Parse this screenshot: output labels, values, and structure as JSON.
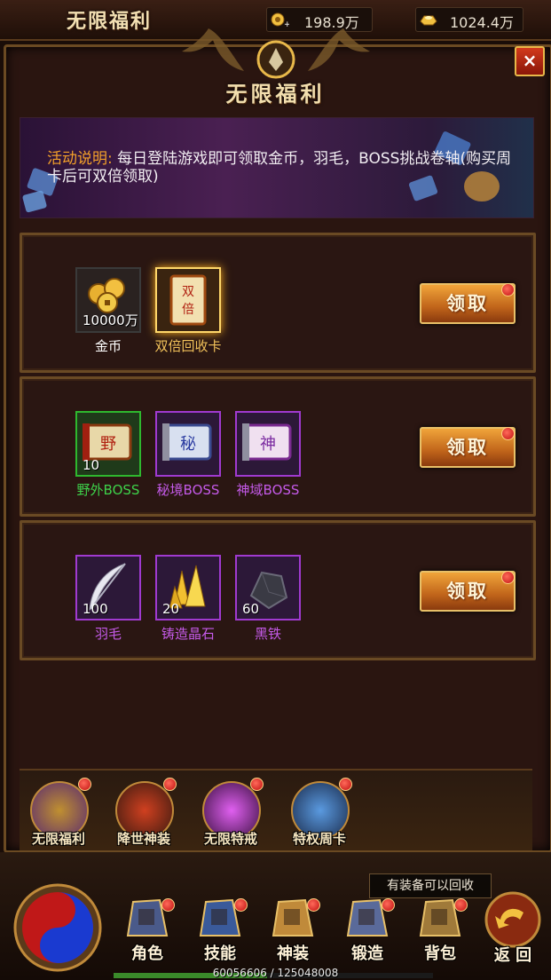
{
  "header": {
    "title": "无限福利",
    "gold": "198.9万",
    "ingot": "1024.4万"
  },
  "panel": {
    "title": "无限福利",
    "close_label": "×",
    "description_label": "活动说明:",
    "description_text": "每日登陆游戏即可领取金币，羽毛，BOSS挑战卷轴(购买周卡后可双倍领取)"
  },
  "rows": [
    {
      "items": [
        {
          "name": "金币",
          "count": "10000万",
          "name_color": "#ffffff",
          "icon": "gold-coins-icon"
        },
        {
          "name": "双倍回收卡",
          "count": "",
          "name_color": "#f2c25a",
          "icon": "double-recycle-card-icon"
        }
      ],
      "button": "领取"
    },
    {
      "items": [
        {
          "name": "野外BOSS",
          "count": "10",
          "name_color": "#3ed24a",
          "icon": "wild-boss-scroll-icon"
        },
        {
          "name": "秘境BOSS",
          "count": "",
          "name_color": "#c45ae8",
          "icon": "secret-boss-scroll-icon"
        },
        {
          "name": "神域BOSS",
          "count": "",
          "name_color": "#c45ae8",
          "icon": "divine-boss-scroll-icon"
        }
      ],
      "button": "领取"
    },
    {
      "items": [
        {
          "name": "羽毛",
          "count": "100",
          "name_color": "#c45ae8",
          "icon": "feather-icon"
        },
        {
          "name": "铸造晶石",
          "count": "20",
          "name_color": "#c45ae8",
          "icon": "forge-crystal-icon"
        },
        {
          "name": "黑铁",
          "count": "60",
          "name_color": "#c45ae8",
          "icon": "black-iron-icon"
        }
      ],
      "button": "领取"
    }
  ],
  "activities": [
    {
      "label": "无限福利",
      "icon": "fortune-bag-icon"
    },
    {
      "label": "降世神装",
      "icon": "divine-gear-icon"
    },
    {
      "label": "无限特戒",
      "icon": "special-ring-icon"
    },
    {
      "label": "特权周卡",
      "icon": "weekly-card-icon"
    }
  ],
  "nav": [
    {
      "label": "角色",
      "icon": "helmet-icon"
    },
    {
      "label": "技能",
      "icon": "skill-book-icon"
    },
    {
      "label": "神装",
      "icon": "divine-armor-icon"
    },
    {
      "label": "锻造",
      "icon": "anvil-icon"
    },
    {
      "label": "背包",
      "icon": "backpack-icon"
    }
  ],
  "back_label": "返 回",
  "tooltip": "有装备可以回收",
  "exp": {
    "current": "60056606",
    "max": "125048008",
    "text": "60056606 / 125048008",
    "fraction": 0.48
  },
  "colors": {
    "accent_gold": "#f2c25a",
    "claim_button": "#d27a24",
    "rare_green": "#2eb82e",
    "epic_purple": "#a03ad0"
  }
}
